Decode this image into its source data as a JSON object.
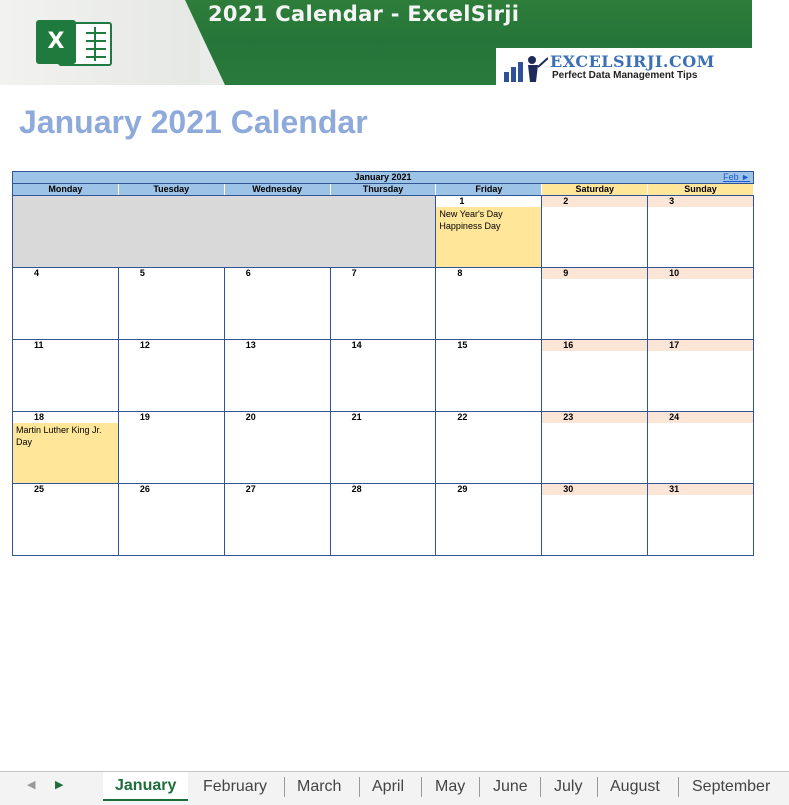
{
  "banner": {
    "title": "2021 Calendar - ExcelSirji",
    "logo_letter": "X",
    "brand_name": "EXCELSIRJI.COM",
    "brand_tagline": "Perfect Data Management Tips"
  },
  "page_title": "January 2021 Calendar",
  "calendar": {
    "month_label": "January 2021",
    "next_link": "Feb ►",
    "weekdays": [
      "Monday",
      "Tuesday",
      "Wednesday",
      "Thursday",
      "Friday",
      "Saturday",
      "Sunday"
    ],
    "weeks": [
      [
        {
          "day": ""
        },
        {
          "day": ""
        },
        {
          "day": ""
        },
        {
          "day": ""
        },
        {
          "day": "1",
          "events": "New Year's Day\nHappiness Day"
        },
        {
          "day": "2"
        },
        {
          "day": "3"
        }
      ],
      [
        {
          "day": "4"
        },
        {
          "day": "5"
        },
        {
          "day": "6"
        },
        {
          "day": "7"
        },
        {
          "day": "8"
        },
        {
          "day": "9"
        },
        {
          "day": "10"
        }
      ],
      [
        {
          "day": "11"
        },
        {
          "day": "12"
        },
        {
          "day": "13"
        },
        {
          "day": "14"
        },
        {
          "day": "15"
        },
        {
          "day": "16"
        },
        {
          "day": "17"
        }
      ],
      [
        {
          "day": "18",
          "events": "Martin Luther King Jr. Day"
        },
        {
          "day": "19"
        },
        {
          "day": "20"
        },
        {
          "day": "21"
        },
        {
          "day": "22"
        },
        {
          "day": "23"
        },
        {
          "day": "24"
        }
      ],
      [
        {
          "day": "25"
        },
        {
          "day": "26"
        },
        {
          "day": "27"
        },
        {
          "day": "28"
        },
        {
          "day": "29"
        },
        {
          "day": "30"
        },
        {
          "day": "31"
        }
      ]
    ]
  },
  "sheet_tabs": {
    "active": "January",
    "tabs": [
      "January",
      "February",
      "March",
      "April",
      "May",
      "June",
      "July",
      "August",
      "September"
    ]
  },
  "colors": {
    "title": "#8eaadb",
    "header_blue": "#9dc3e6",
    "weekend_header": "#ffe699",
    "weekend_day": "#fbe5d6",
    "holiday": "#ffe699",
    "empty": "#d9d9d9",
    "active_tab": "#1e6e3c"
  }
}
